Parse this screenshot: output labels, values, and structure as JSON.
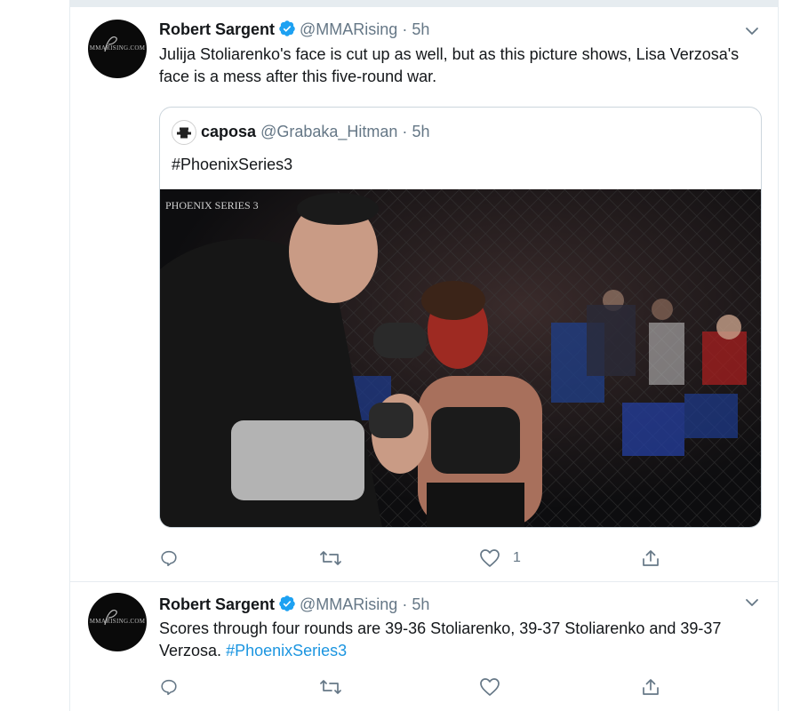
{
  "tweets": [
    {
      "avatar_icon": "mmarising-logo",
      "author_name": "Robert Sargent",
      "handle": "@MMARising",
      "separator": "·",
      "time": "5h",
      "text": "Julija Stoliarenko's face is cut up as well, but as this picture shows, Lisa Verzosa's face is a mess after this five-round war.",
      "quote": {
        "author_name": "caposa",
        "handle": "@Grabaka_Hitman",
        "separator": "·",
        "time": "5h",
        "text": "#PhoenixSeries3",
        "watermark": "PHOENIX SERIES 3"
      },
      "actions": {
        "reply_count": "",
        "retweet_count": "",
        "like_count": "1"
      }
    },
    {
      "avatar_icon": "mmarising-logo",
      "author_name": "Robert Sargent",
      "handle": "@MMARising",
      "separator": "·",
      "time": "5h",
      "text_plain": "Scores through four rounds are 39-36 Stoliarenko, 39-37 Stoliarenko and 39-37 Verzosa.",
      "hashtag": "#PhoenixSeries3",
      "actions": {
        "reply_count": "",
        "retweet_count": "",
        "like_count": ""
      }
    }
  ],
  "colors": {
    "accent": "#1da1f2",
    "link": "#1b95e0",
    "muted": "#657786",
    "border": "#e6ecf0"
  }
}
